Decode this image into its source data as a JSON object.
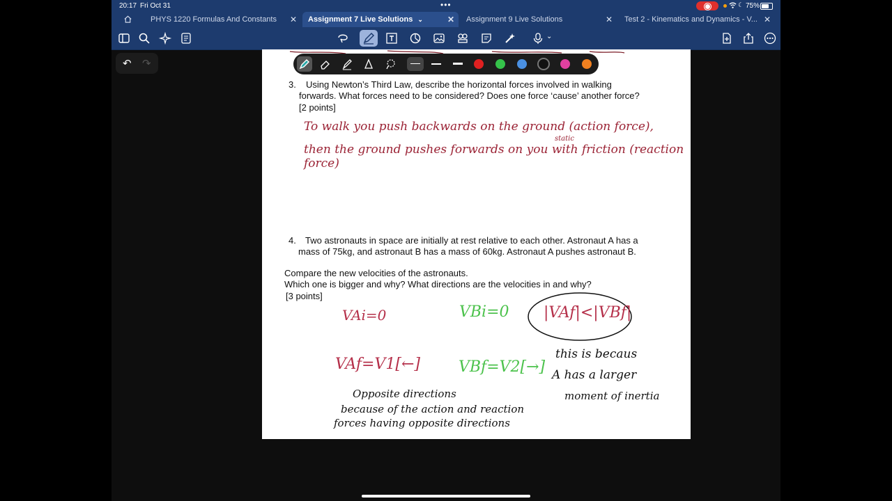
{
  "status": {
    "time": "20:17",
    "date": "Fri Oct 31",
    "battery": "75%"
  },
  "tabs": [
    {
      "label": "PHYS 1220 Formulas And Constants",
      "active": false
    },
    {
      "label": "Assignment 7 Live Solutions",
      "active": true
    },
    {
      "label": "Assignment 9 Live Solutions",
      "active": false
    },
    {
      "label": "Test 2 - Kinematics and Dynamics - V...",
      "active": false
    }
  ],
  "palette": {
    "colors": [
      "#e02020",
      "#35c24a",
      "#4a90e2",
      "#111111",
      "#e040a0",
      "#f08020"
    ]
  },
  "document": {
    "q3": {
      "number": "3.",
      "line1": "Using Newton’s Third Law, describe the horizontal forces involved in walking",
      "line2": "forwards. What forces need to be considered? Does one force ‘cause’ another force?",
      "points": "[2 points]"
    },
    "q3_answer": {
      "line1": "To walk you push backwards on the ground (action force),",
      "line2": "then the ground pushes forwards on you with friction (reaction force)",
      "insert": "static"
    },
    "q4": {
      "number": "4.",
      "line1": "Two astronauts in space are initially at rest relative to each other. Astronaut A has a",
      "line2": "mass of 75kg, and astronaut B has a mass of 60kg. Astronaut A pushes astronaut B.",
      "compare": "Compare the new velocities of the astronauts.",
      "which": "Which one is bigger and why? What directions are the velocities in and why?",
      "points": "[3 points]"
    },
    "q4_answer": {
      "va_initial": "VAi=0",
      "vb_initial": "VBi=0",
      "compare": "|VAf|<|VBf|",
      "va_final": "VAf=V1[←]",
      "vb_final": "VBf=V2[→]",
      "reason1": "this is becaus",
      "reason2": "A has a larger",
      "reason3": "moment of inertia",
      "dir1": "Opposite directions",
      "dir2": "because of the action and reaction",
      "dir3": "forces having opposite directions"
    }
  }
}
